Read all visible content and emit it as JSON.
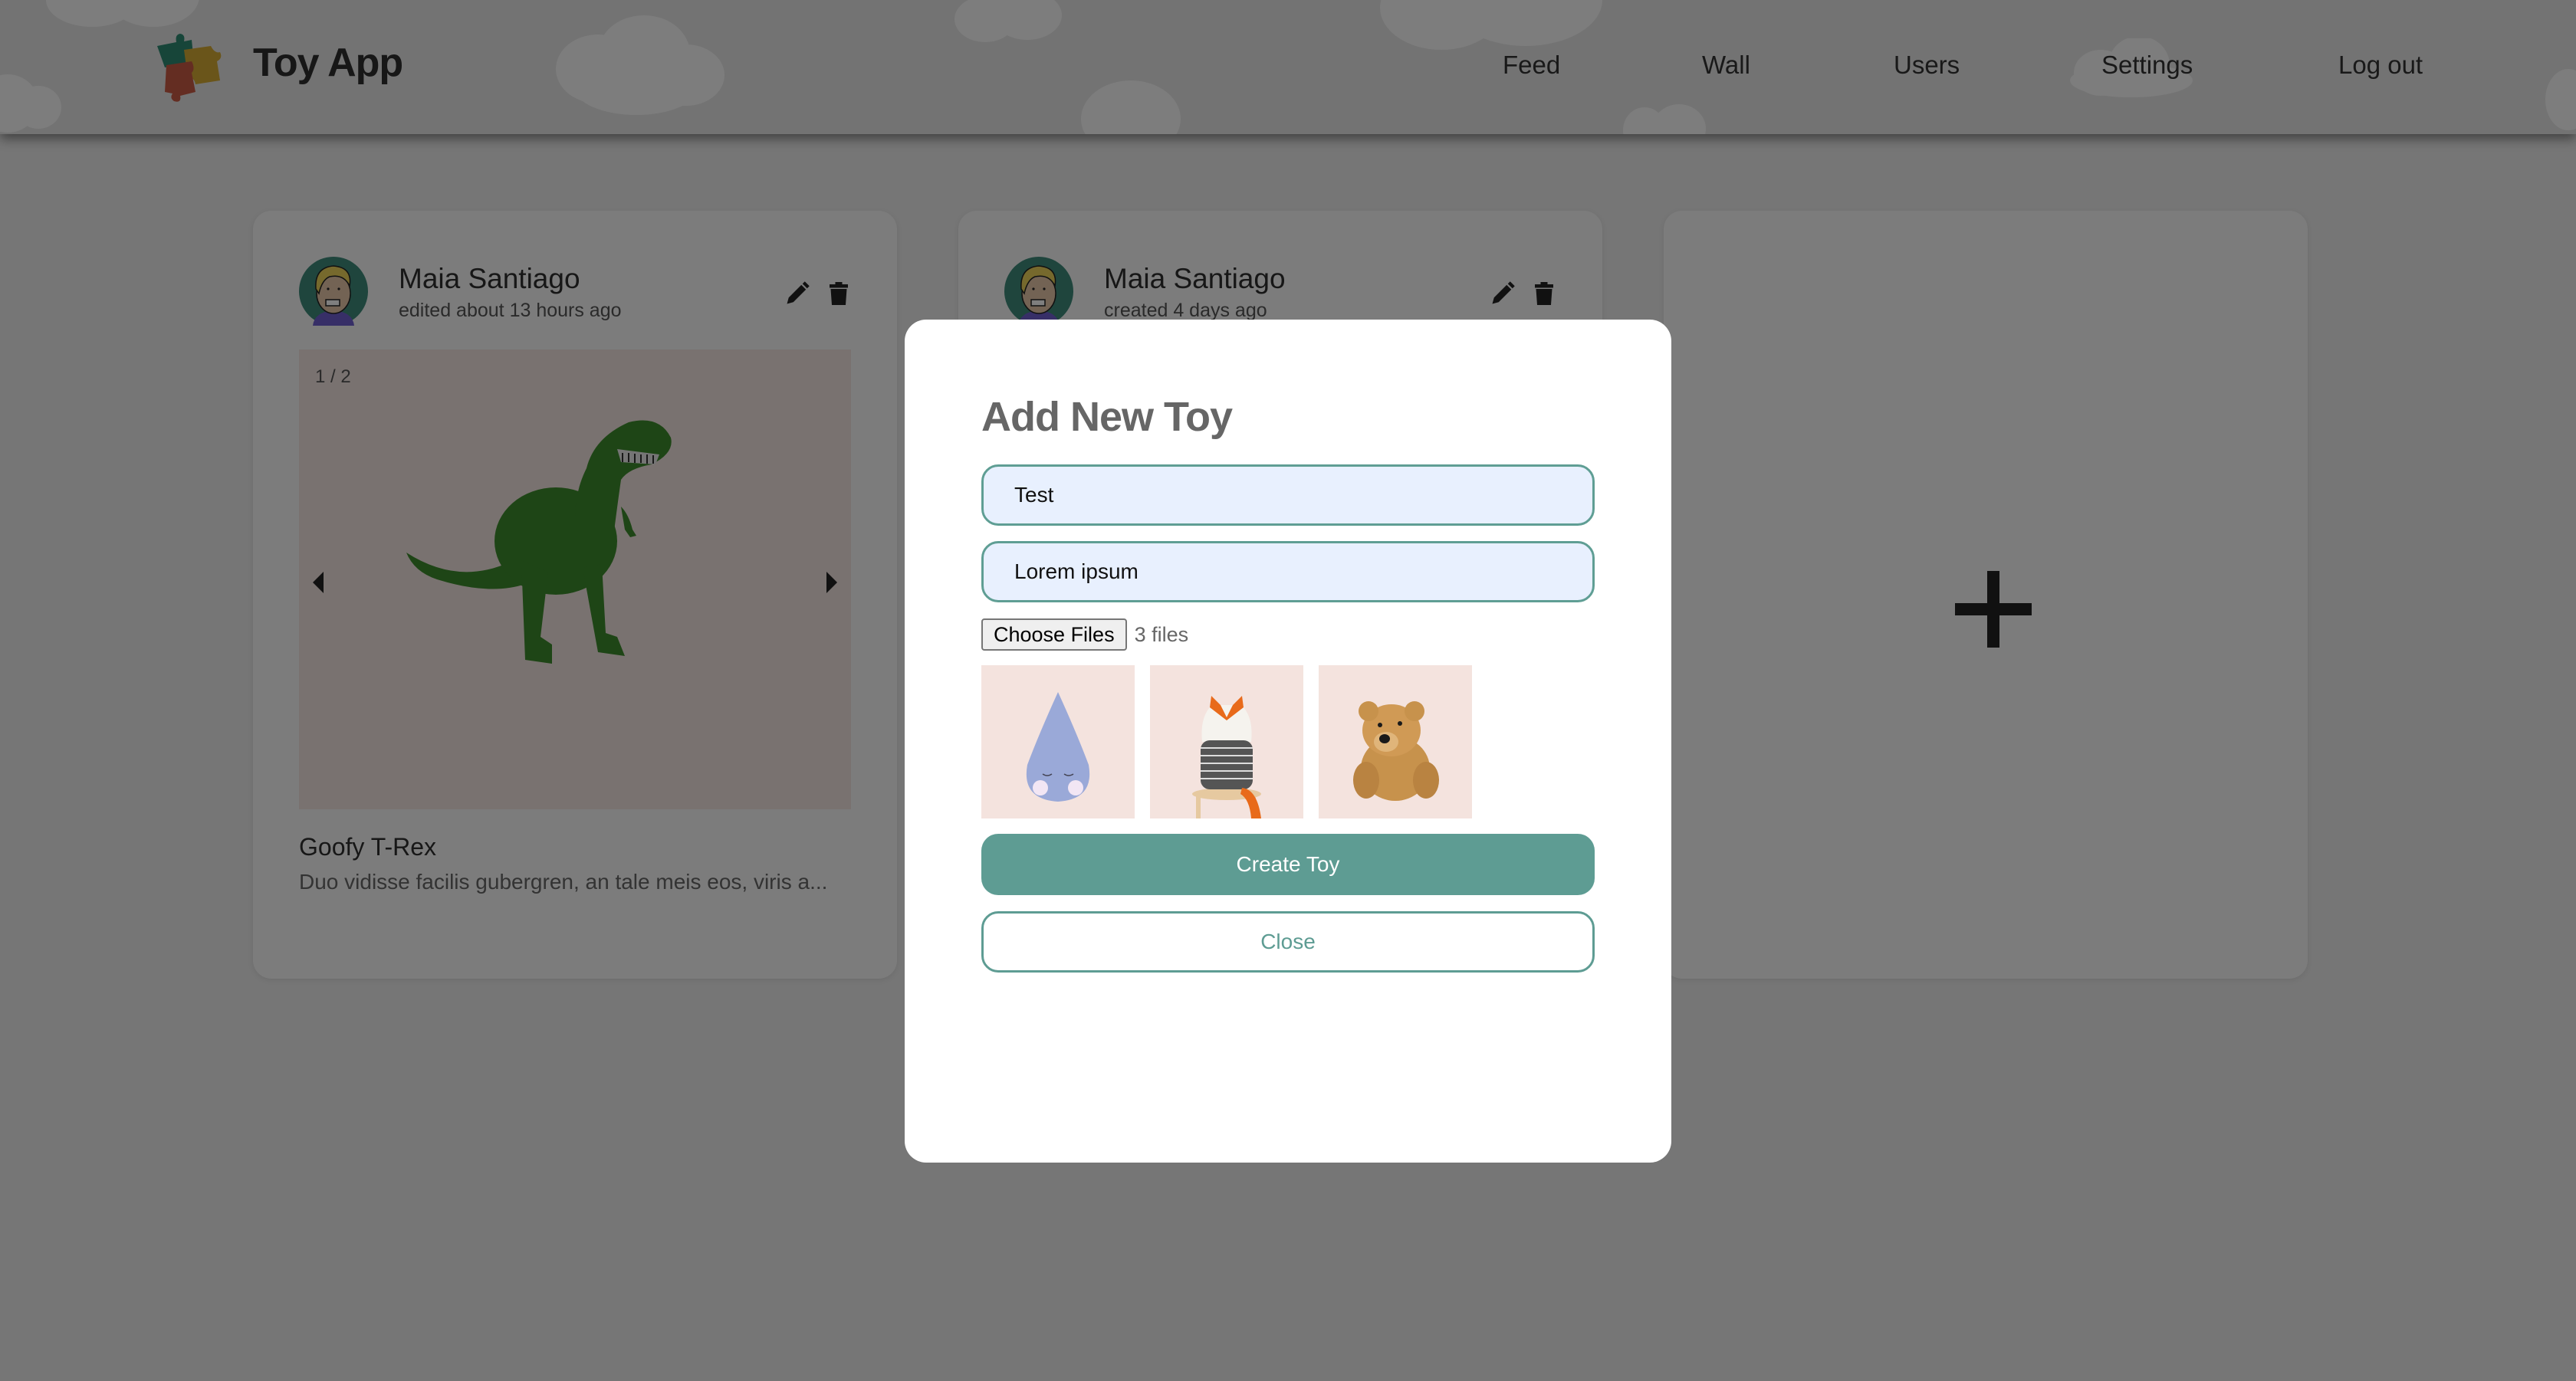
{
  "header": {
    "app_title": "Toy App",
    "logo_icon": "puzzle-pieces-icon",
    "nav": [
      {
        "label": "Feed"
      },
      {
        "label": "Wall"
      },
      {
        "label": "Users"
      },
      {
        "label": "Settings"
      },
      {
        "label": "Log out"
      }
    ]
  },
  "feed": {
    "cards": [
      {
        "author": "Maia Santiago",
        "timestamp": "edited about 13 hours ago",
        "carousel_counter": "1 / 2",
        "carousel_position": {
          "current": 1,
          "total": 2
        },
        "image_subject": "green t-rex toy",
        "title": "Goofy T-Rex",
        "description": "Duo vidisse facilis gubergren, an tale meis eos, viris a...",
        "actions": {
          "edit_icon": "pencil-icon",
          "delete_icon": "trash-icon"
        }
      },
      {
        "author": "Maia Santiago",
        "timestamp": "created 4 days ago",
        "actions": {
          "edit_icon": "pencil-icon",
          "delete_icon": "trash-icon"
        }
      }
    ],
    "add_card": {
      "icon": "plus-icon"
    }
  },
  "modal": {
    "title": "Add New Toy",
    "name_field": {
      "value": "Test"
    },
    "description_field": {
      "value": "Lorem ipsum"
    },
    "file_input": {
      "button_label": "Choose Files",
      "status": "3 files"
    },
    "previews": [
      {
        "subject": "blue raindrop plush"
      },
      {
        "subject": "fox plush on stool"
      },
      {
        "subject": "teddy bear"
      }
    ],
    "create_label": "Create Toy",
    "close_label": "Close"
  },
  "colors": {
    "accent": "#5e9c93",
    "input_bg": "#e8f0fe",
    "overlay": "rgba(0,0,0,0.5)",
    "preview_bg": "#f4e3de"
  }
}
